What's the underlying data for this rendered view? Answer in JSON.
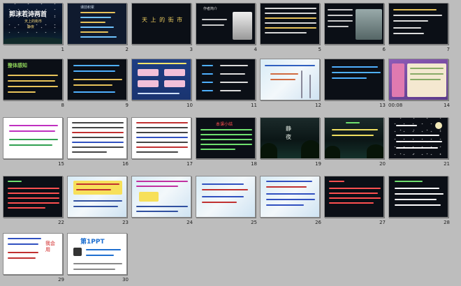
{
  "slides": [
    {
      "n": "1",
      "lines": [
        "郭沫若诗两首",
        "天上的街市",
        "静夜"
      ]
    },
    {
      "n": "2",
      "lines": [
        "课前积累"
      ]
    },
    {
      "n": "3",
      "lines": [
        "天 上 的 街 市"
      ]
    },
    {
      "n": "4",
      "lines": [
        "作者简介"
      ]
    },
    {
      "n": "5",
      "lines": []
    },
    {
      "n": "6",
      "lines": []
    },
    {
      "n": "7",
      "lines": []
    },
    {
      "n": "8",
      "lines": [
        "整体感知"
      ]
    },
    {
      "n": "9",
      "lines": []
    },
    {
      "n": "10",
      "lines": []
    },
    {
      "n": "11",
      "lines": []
    },
    {
      "n": "12",
      "lines": []
    },
    {
      "n": "13",
      "lines": []
    },
    {
      "n": "14",
      "timing": "00:08",
      "lines": []
    },
    {
      "n": "15",
      "lines": []
    },
    {
      "n": "16",
      "lines": []
    },
    {
      "n": "17",
      "lines": []
    },
    {
      "n": "18",
      "lines": [
        "本课小结"
      ]
    },
    {
      "n": "19",
      "lines": [
        "静",
        "夜"
      ]
    },
    {
      "n": "20",
      "lines": []
    },
    {
      "n": "21",
      "lines": []
    },
    {
      "n": "22",
      "lines": []
    },
    {
      "n": "23",
      "lines": []
    },
    {
      "n": "24",
      "lines": []
    },
    {
      "n": "25",
      "lines": []
    },
    {
      "n": "26",
      "lines": []
    },
    {
      "n": "27",
      "lines": []
    },
    {
      "n": "28",
      "lines": []
    },
    {
      "n": "29",
      "lines": [
        "我会用"
      ]
    },
    {
      "n": "30",
      "lines": [
        "第1PPT"
      ]
    }
  ]
}
